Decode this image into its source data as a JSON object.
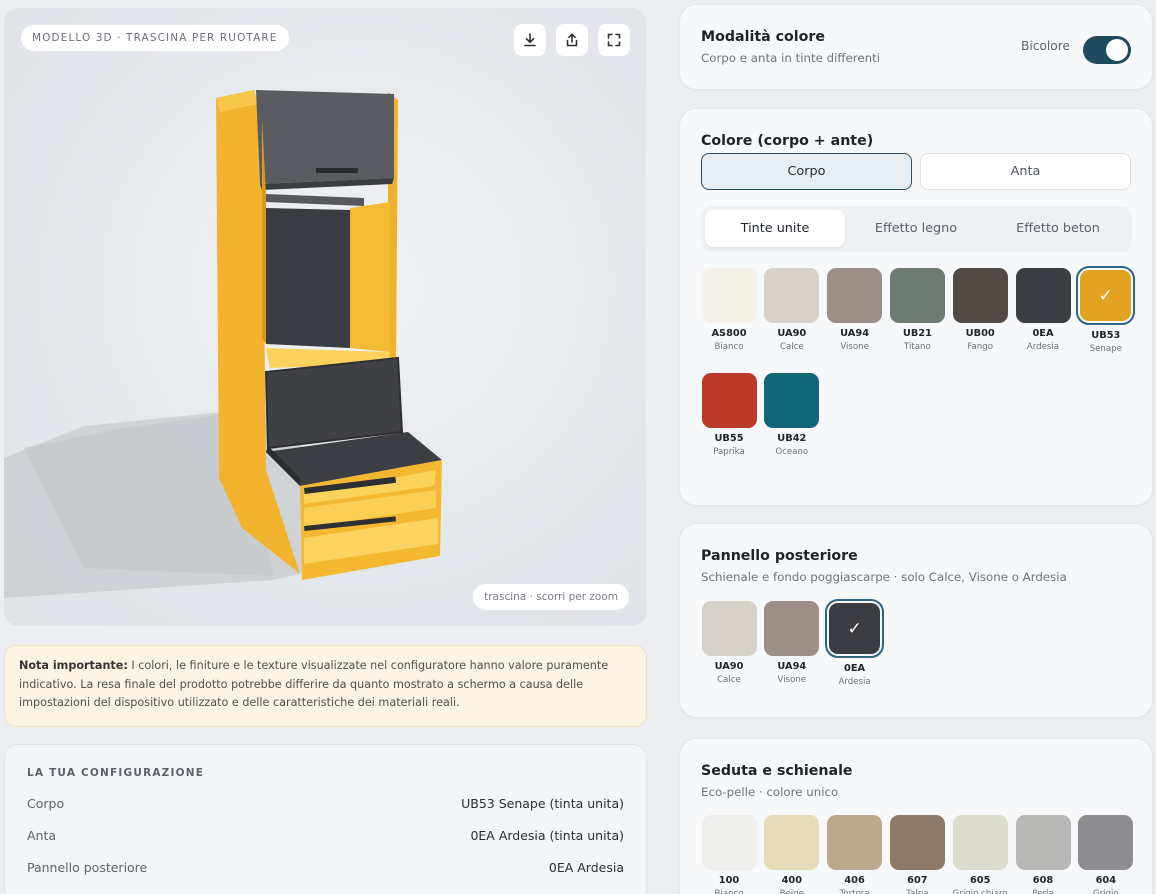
{
  "viewer": {
    "tag": "MODELLO 3D · TRASCINA PER RUOTARE",
    "hint": "trascina · scorri per zoom",
    "buttons": [
      {
        "icon": "download-icon"
      },
      {
        "icon": "share-icon"
      },
      {
        "icon": "fullscreen-icon"
      }
    ]
  },
  "note": {
    "bold": "Nota importante:",
    "text": " I colori, le finiture e le texture visualizzate nel configuratore hanno valore puramente indicativo. La resa finale del prodotto potrebbe differire da quanto mostrato a schermo a causa delle impostazioni del dispositivo utilizzato e delle caratteristiche dei materiali reali."
  },
  "summary": {
    "title": "LA TUA CONFIGURAZIONE",
    "rows": [
      {
        "label": "Corpo",
        "value": "UB53 Senape (tinta unita)"
      },
      {
        "label": "Anta",
        "value": "0EA Ardesia (tinta unita)"
      },
      {
        "label": "Pannello posteriore",
        "value": "0EA Ardesia"
      }
    ]
  },
  "color_mode": {
    "title": "Modalità colore",
    "subtitle": "Corpo e anta in tinte differenti",
    "toggle_label": "Bicolore",
    "toggle_on": true
  },
  "colors": {
    "title": "Colore (corpo + ante)",
    "targets": [
      "Corpo",
      "Anta"
    ],
    "active_target": "Corpo",
    "tabs": [
      "Tinte unite",
      "Effetto legno",
      "Effetto beton"
    ],
    "active_tab": "Tinte unite",
    "swatches": [
      {
        "code": "AS800",
        "name": "Bianco",
        "color": "#f4f1e8"
      },
      {
        "code": "UA90",
        "name": "Calce",
        "color": "#d6d1cb"
      },
      {
        "code": "UA94",
        "name": "Visone",
        "color": "#9c8f89"
      },
      {
        "code": "UB21",
        "name": "Titano",
        "color": "#6f7a72"
      },
      {
        "code": "UB00",
        "name": "Fango",
        "color": "#514a47"
      },
      {
        "code": "0EA",
        "name": "Ardesia",
        "color": "#3c3d42"
      },
      {
        "code": "UB53",
        "name": "Senape",
        "color": "#e2a322",
        "selected": true
      },
      {
        "code": "UB55",
        "name": "Paprika",
        "color": "#bb3a2a"
      },
      {
        "code": "UB42",
        "name": "Oceano",
        "color": "#136578"
      }
    ]
  },
  "back_panel": {
    "title": "Pannello posteriore",
    "subtitle": "Schienale e fondo poggiascarpe · solo Calce, Visone o Ardesia",
    "swatches": [
      {
        "code": "UA90",
        "name": "Calce",
        "color": "#d6d1cb"
      },
      {
        "code": "UA94",
        "name": "Visone",
        "color": "#9c8f89"
      },
      {
        "code": "0EA",
        "name": "Ardesia",
        "color": "#3c3d42",
        "selected": true
      }
    ]
  },
  "seat": {
    "title": "Seduta e schienale",
    "subtitle": "Eco-pelle · colore unico",
    "swatches": [
      {
        "code": "100",
        "name": "Bianco",
        "color": "#eeeeec"
      },
      {
        "code": "400",
        "name": "Beige",
        "color": "#e8dcb8"
      },
      {
        "code": "406",
        "name": "Tortora",
        "color": "#bca88e"
      },
      {
        "code": "607",
        "name": "Talpa",
        "color": "#8d7a6a"
      },
      {
        "code": "605",
        "name": "Grigio chiaro",
        "color": "#dcdccc"
      },
      {
        "code": "608",
        "name": "Perla",
        "color": "#b8b8b6"
      },
      {
        "code": "604",
        "name": "Grigio",
        "color": "#8e8e90"
      }
    ]
  }
}
